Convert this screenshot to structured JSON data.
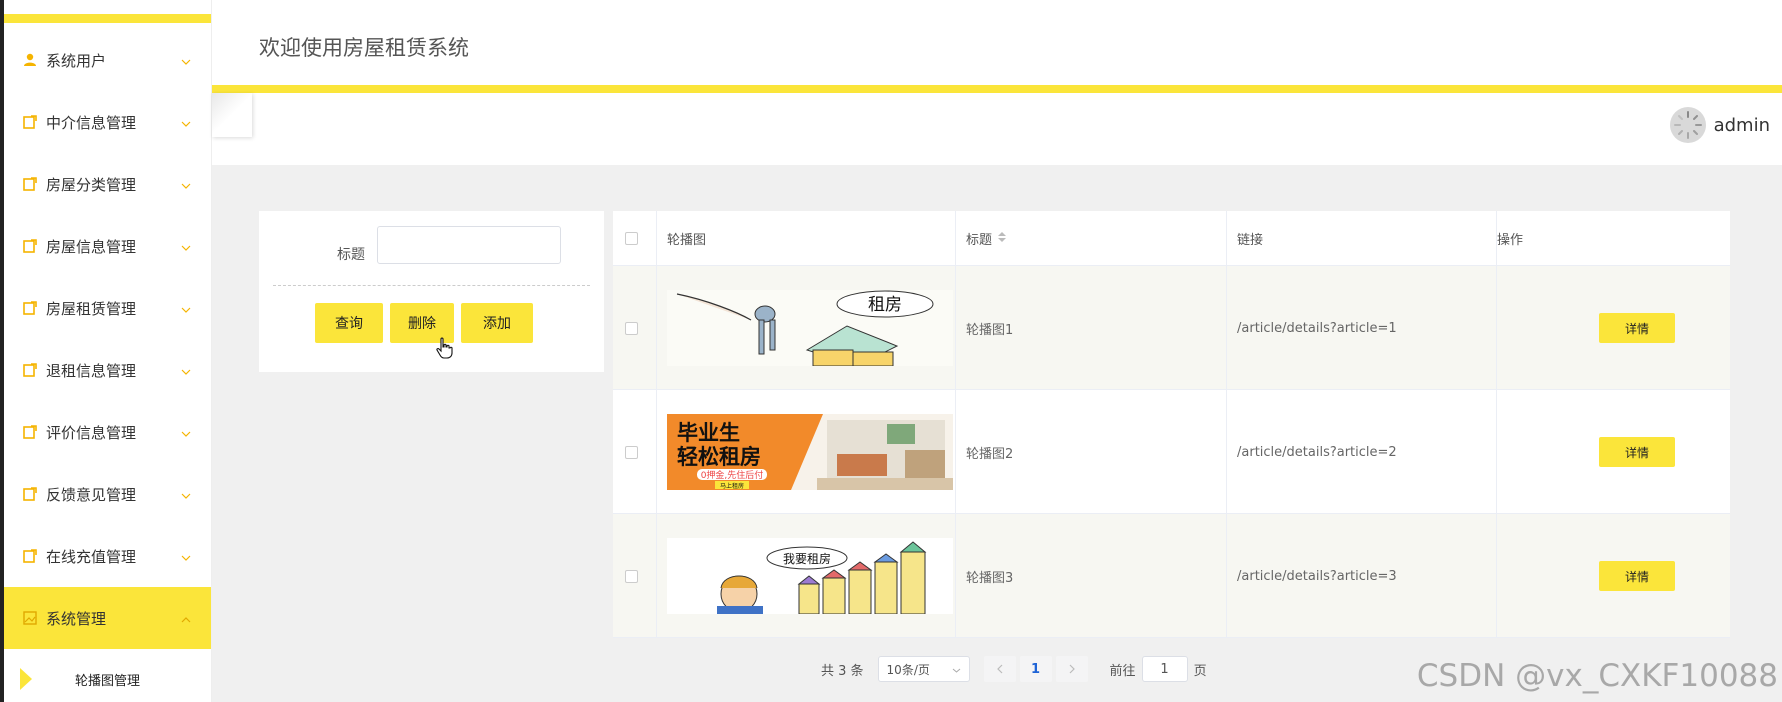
{
  "header": {
    "title": "欢迎使用房屋租赁系统"
  },
  "user": {
    "name": "admin"
  },
  "sidebar": {
    "items": [
      {
        "label": "系统用户",
        "icon": "user-icon"
      },
      {
        "label": "中介信息管理",
        "icon": "edit-icon"
      },
      {
        "label": "房屋分类管理",
        "icon": "edit-icon"
      },
      {
        "label": "房屋信息管理",
        "icon": "edit-icon"
      },
      {
        "label": "房屋租赁管理",
        "icon": "edit-icon"
      },
      {
        "label": "退租信息管理",
        "icon": "edit-icon"
      },
      {
        "label": "评价信息管理",
        "icon": "edit-icon"
      },
      {
        "label": "反馈意见管理",
        "icon": "edit-icon"
      },
      {
        "label": "在线充值管理",
        "icon": "edit-icon"
      },
      {
        "label": "系统管理",
        "icon": "image-icon",
        "active": true
      }
    ],
    "subitems": [
      {
        "label": "轮播图管理"
      }
    ]
  },
  "search": {
    "label": "标题",
    "value": "",
    "buttons": {
      "query": "查询",
      "delete": "删除",
      "add": "添加"
    }
  },
  "table": {
    "columns": {
      "image": "轮播图",
      "title": "标题",
      "link": "链接",
      "action": "操作"
    },
    "rows": [
      {
        "title": "轮播图1",
        "link": "/article/details?article=1",
        "action": "详情",
        "image_text": "租房"
      },
      {
        "title": "轮播图2",
        "link": "/article/details?article=2",
        "action": "详情",
        "image_text_1": "毕业生",
        "image_text_2": "轻松租房",
        "image_text_3": "0押金,先住后付",
        "image_text_4": "马上租房"
      },
      {
        "title": "轮播图3",
        "link": "/article/details?article=3",
        "action": "详情",
        "image_text": "我要租房"
      }
    ]
  },
  "pagination": {
    "total": "共 3 条",
    "page_size": "10条/页",
    "current": "1",
    "goto_prefix": "前往",
    "goto_value": "1",
    "goto_suffix": "页"
  },
  "watermark": "CSDN @vx_CXKF10088",
  "colors": {
    "accent": "#fbe53a",
    "page_link": "#1e63d6"
  }
}
